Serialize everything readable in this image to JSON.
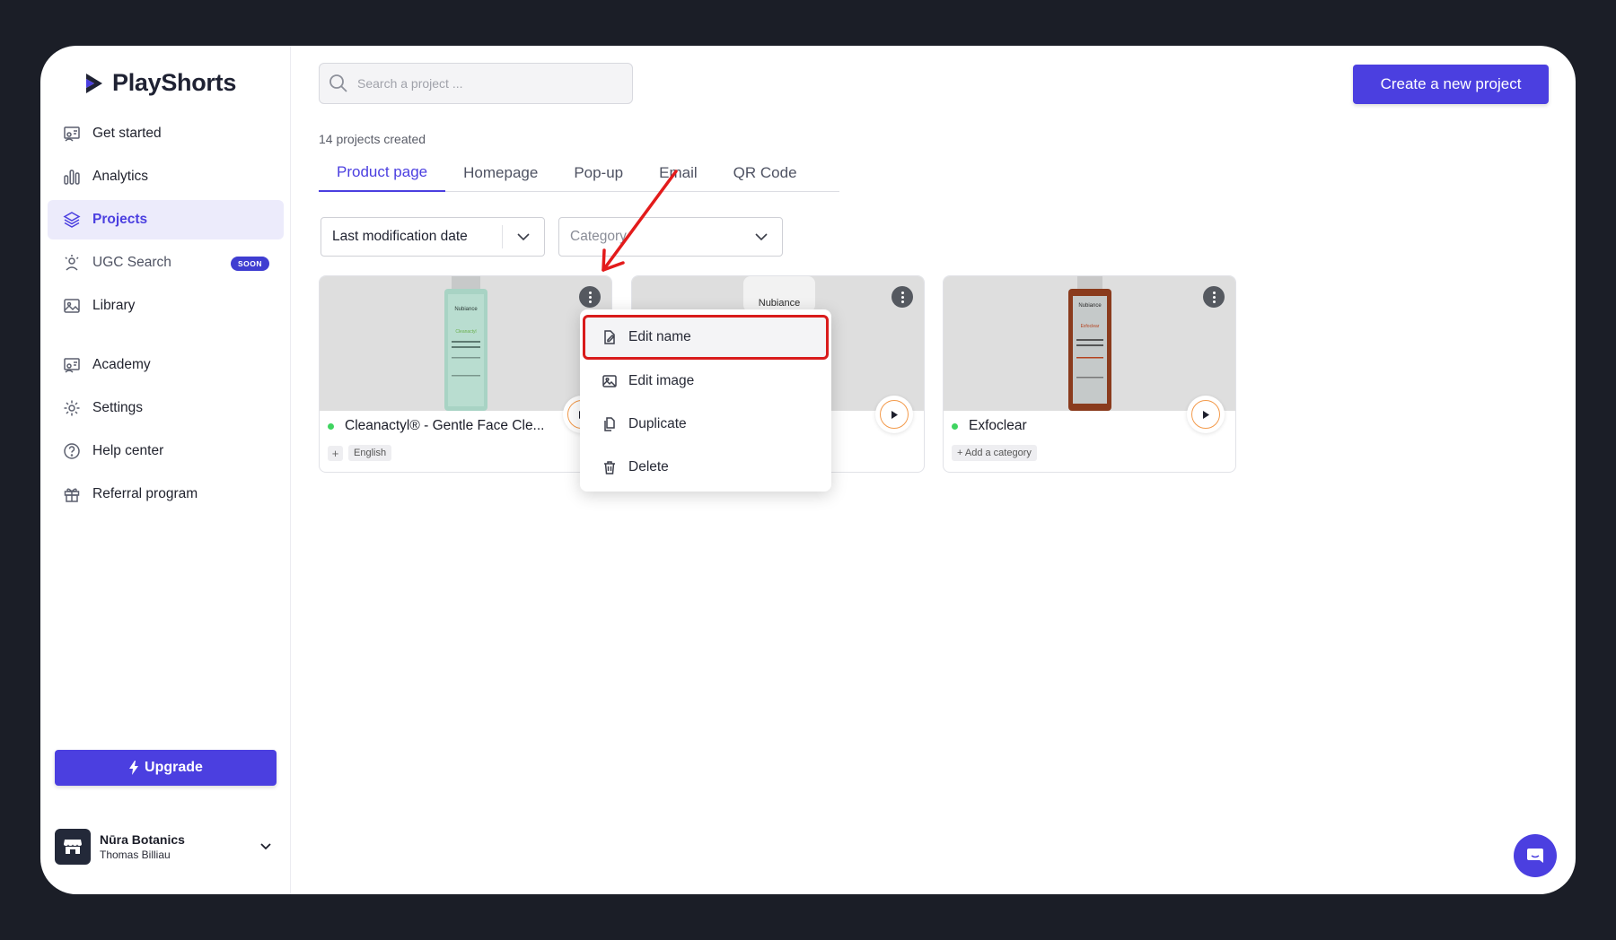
{
  "brand": {
    "name": "PlayShorts"
  },
  "sidebar": {
    "items": [
      {
        "label": "Get started",
        "icon": "get-started-icon"
      },
      {
        "label": "Analytics",
        "icon": "analytics-icon"
      },
      {
        "label": "Projects",
        "icon": "projects-icon",
        "active": true
      },
      {
        "label": "UGC Search",
        "icon": "ugc-search-icon",
        "badge": "SOON"
      },
      {
        "label": "Library",
        "icon": "library-icon"
      },
      {
        "label": "Academy",
        "icon": "academy-icon"
      },
      {
        "label": "Settings",
        "icon": "settings-icon"
      },
      {
        "label": "Help center",
        "icon": "help-icon"
      },
      {
        "label": "Referral program",
        "icon": "gift-icon"
      }
    ],
    "upgrade_label": "Upgrade",
    "account": {
      "org": "Nūra Botanics",
      "user": "Thomas Billiau"
    }
  },
  "search": {
    "placeholder": "Search a project ...",
    "value": ""
  },
  "create_label": "Create a new project",
  "project_count": "14 projects created",
  "tabs": [
    {
      "label": "Product page",
      "active": true
    },
    {
      "label": "Homepage"
    },
    {
      "label": "Pop-up"
    },
    {
      "label": "Email"
    },
    {
      "label": "QR Code"
    }
  ],
  "filters": {
    "sort": "Last modification date",
    "category_placeholder": "Category"
  },
  "cards": [
    {
      "title": "Cleanactyl® - Gentle Face Cle...",
      "tag": "English",
      "bottle_brand": "Nubiance",
      "bottle_product": "Cleanactyl"
    },
    {
      "title": "",
      "bottle_brand": "Nubiance"
    },
    {
      "title": "Exfoclear",
      "tag": "Add a category",
      "bottle_brand": "Nubiance",
      "bottle_product": "Exfoclear"
    }
  ],
  "context_menu": {
    "items": [
      {
        "label": "Edit name",
        "icon": "edit-icon",
        "highlighted": true
      },
      {
        "label": "Edit image",
        "icon": "image-icon"
      },
      {
        "label": "Duplicate",
        "icon": "duplicate-icon"
      },
      {
        "label": "Delete",
        "icon": "trash-icon"
      }
    ]
  },
  "colors": {
    "accent": "#4b3fe0",
    "highlight": "#d91b1b",
    "status": "#3fd460"
  }
}
